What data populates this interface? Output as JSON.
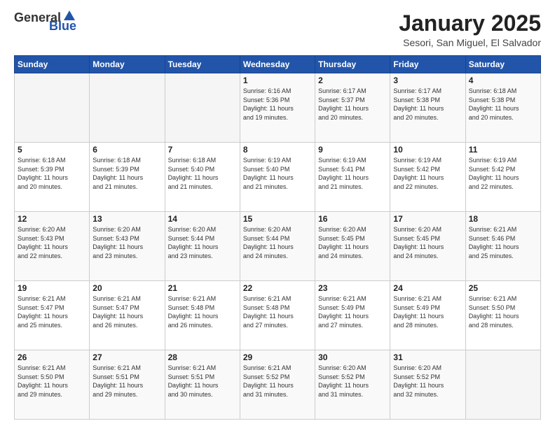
{
  "logo": {
    "text1": "General",
    "text2": "Blue"
  },
  "header": {
    "month": "January 2025",
    "location": "Sesori, San Miguel, El Salvador"
  },
  "days_of_week": [
    "Sunday",
    "Monday",
    "Tuesday",
    "Wednesday",
    "Thursday",
    "Friday",
    "Saturday"
  ],
  "weeks": [
    [
      {
        "day": "",
        "info": ""
      },
      {
        "day": "",
        "info": ""
      },
      {
        "day": "",
        "info": ""
      },
      {
        "day": "1",
        "info": "Sunrise: 6:16 AM\nSunset: 5:36 PM\nDaylight: 11 hours\nand 19 minutes."
      },
      {
        "day": "2",
        "info": "Sunrise: 6:17 AM\nSunset: 5:37 PM\nDaylight: 11 hours\nand 20 minutes."
      },
      {
        "day": "3",
        "info": "Sunrise: 6:17 AM\nSunset: 5:38 PM\nDaylight: 11 hours\nand 20 minutes."
      },
      {
        "day": "4",
        "info": "Sunrise: 6:18 AM\nSunset: 5:38 PM\nDaylight: 11 hours\nand 20 minutes."
      }
    ],
    [
      {
        "day": "5",
        "info": "Sunrise: 6:18 AM\nSunset: 5:39 PM\nDaylight: 11 hours\nand 20 minutes."
      },
      {
        "day": "6",
        "info": "Sunrise: 6:18 AM\nSunset: 5:39 PM\nDaylight: 11 hours\nand 21 minutes."
      },
      {
        "day": "7",
        "info": "Sunrise: 6:18 AM\nSunset: 5:40 PM\nDaylight: 11 hours\nand 21 minutes."
      },
      {
        "day": "8",
        "info": "Sunrise: 6:19 AM\nSunset: 5:40 PM\nDaylight: 11 hours\nand 21 minutes."
      },
      {
        "day": "9",
        "info": "Sunrise: 6:19 AM\nSunset: 5:41 PM\nDaylight: 11 hours\nand 21 minutes."
      },
      {
        "day": "10",
        "info": "Sunrise: 6:19 AM\nSunset: 5:42 PM\nDaylight: 11 hours\nand 22 minutes."
      },
      {
        "day": "11",
        "info": "Sunrise: 6:19 AM\nSunset: 5:42 PM\nDaylight: 11 hours\nand 22 minutes."
      }
    ],
    [
      {
        "day": "12",
        "info": "Sunrise: 6:20 AM\nSunset: 5:43 PM\nDaylight: 11 hours\nand 22 minutes."
      },
      {
        "day": "13",
        "info": "Sunrise: 6:20 AM\nSunset: 5:43 PM\nDaylight: 11 hours\nand 23 minutes."
      },
      {
        "day": "14",
        "info": "Sunrise: 6:20 AM\nSunset: 5:44 PM\nDaylight: 11 hours\nand 23 minutes."
      },
      {
        "day": "15",
        "info": "Sunrise: 6:20 AM\nSunset: 5:44 PM\nDaylight: 11 hours\nand 24 minutes."
      },
      {
        "day": "16",
        "info": "Sunrise: 6:20 AM\nSunset: 5:45 PM\nDaylight: 11 hours\nand 24 minutes."
      },
      {
        "day": "17",
        "info": "Sunrise: 6:20 AM\nSunset: 5:45 PM\nDaylight: 11 hours\nand 24 minutes."
      },
      {
        "day": "18",
        "info": "Sunrise: 6:21 AM\nSunset: 5:46 PM\nDaylight: 11 hours\nand 25 minutes."
      }
    ],
    [
      {
        "day": "19",
        "info": "Sunrise: 6:21 AM\nSunset: 5:47 PM\nDaylight: 11 hours\nand 25 minutes."
      },
      {
        "day": "20",
        "info": "Sunrise: 6:21 AM\nSunset: 5:47 PM\nDaylight: 11 hours\nand 26 minutes."
      },
      {
        "day": "21",
        "info": "Sunrise: 6:21 AM\nSunset: 5:48 PM\nDaylight: 11 hours\nand 26 minutes."
      },
      {
        "day": "22",
        "info": "Sunrise: 6:21 AM\nSunset: 5:48 PM\nDaylight: 11 hours\nand 27 minutes."
      },
      {
        "day": "23",
        "info": "Sunrise: 6:21 AM\nSunset: 5:49 PM\nDaylight: 11 hours\nand 27 minutes."
      },
      {
        "day": "24",
        "info": "Sunrise: 6:21 AM\nSunset: 5:49 PM\nDaylight: 11 hours\nand 28 minutes."
      },
      {
        "day": "25",
        "info": "Sunrise: 6:21 AM\nSunset: 5:50 PM\nDaylight: 11 hours\nand 28 minutes."
      }
    ],
    [
      {
        "day": "26",
        "info": "Sunrise: 6:21 AM\nSunset: 5:50 PM\nDaylight: 11 hours\nand 29 minutes."
      },
      {
        "day": "27",
        "info": "Sunrise: 6:21 AM\nSunset: 5:51 PM\nDaylight: 11 hours\nand 29 minutes."
      },
      {
        "day": "28",
        "info": "Sunrise: 6:21 AM\nSunset: 5:51 PM\nDaylight: 11 hours\nand 30 minutes."
      },
      {
        "day": "29",
        "info": "Sunrise: 6:21 AM\nSunset: 5:52 PM\nDaylight: 11 hours\nand 31 minutes."
      },
      {
        "day": "30",
        "info": "Sunrise: 6:20 AM\nSunset: 5:52 PM\nDaylight: 11 hours\nand 31 minutes."
      },
      {
        "day": "31",
        "info": "Sunrise: 6:20 AM\nSunset: 5:52 PM\nDaylight: 11 hours\nand 32 minutes."
      },
      {
        "day": "",
        "info": ""
      }
    ]
  ]
}
